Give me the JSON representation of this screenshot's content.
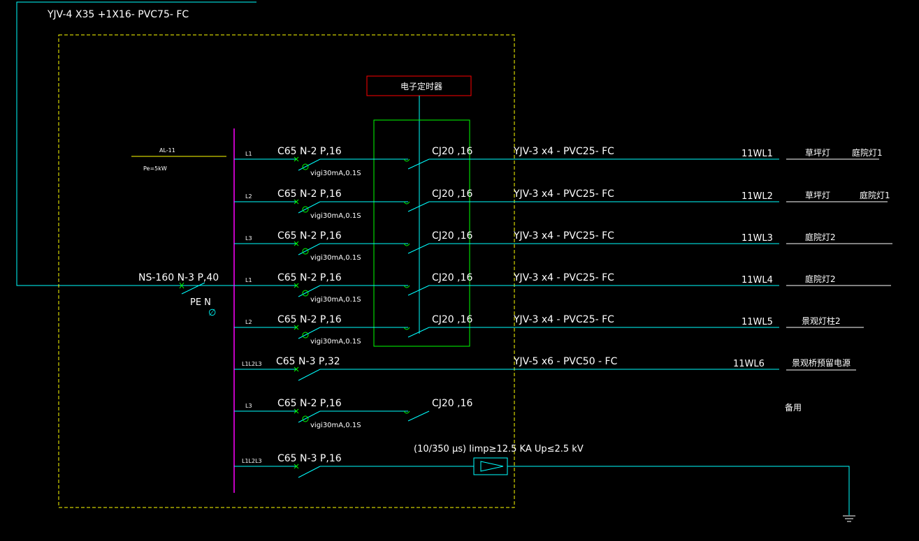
{
  "colors": {
    "background": "#000000",
    "wire": "#00ffff",
    "wire_dim": "#33cccc",
    "bus": "#ff00ff",
    "breaker": "#00ff00",
    "timer_box": "#ff0000",
    "contactor_box": "#00ff00",
    "enclosure": "#ffff00",
    "text": "#ffffff"
  },
  "incoming": {
    "cable": "YJV-4 X35 +1X16- PVC75- FC",
    "main_breaker": "NS-160 N-3 P,40",
    "pe_n": "PE N",
    "neutral_symbol": "∅"
  },
  "panel": {
    "name": "AL-11",
    "load": "Pe=5kW"
  },
  "timer": {
    "label": "电子定时器"
  },
  "circuits": [
    {
      "phase": "L1",
      "breaker": "C65 N-2 P,16",
      "rcd": "vigi30mA,0.1S",
      "contactor": "CJ20 ,16",
      "cable": "YJV-3 x4 - PVC25- FC",
      "id": "11WL1",
      "loads": [
        "草坪灯",
        "庭院灯1"
      ]
    },
    {
      "phase": "L2",
      "breaker": "C65 N-2 P,16",
      "rcd": "vigi30mA,0.1S",
      "contactor": "CJ20 ,16",
      "cable": "YJV-3 x4 - PVC25- FC",
      "id": "11WL2",
      "loads": [
        "草坪灯",
        "庭院灯1"
      ]
    },
    {
      "phase": "L3",
      "breaker": "C65 N-2 P,16",
      "rcd": "vigi30mA,0.1S",
      "contactor": "CJ20 ,16",
      "cable": "YJV-3 x4 - PVC25- FC",
      "id": "11WL3",
      "loads": [
        "庭院灯2"
      ]
    },
    {
      "phase": "L1",
      "breaker": "C65 N-2 P,16",
      "rcd": "vigi30mA,0.1S",
      "contactor": "CJ20 ,16",
      "cable": "YJV-3 x4 - PVC25- FC",
      "id": "11WL4",
      "loads": [
        "庭院灯2"
      ]
    },
    {
      "phase": "L2",
      "breaker": "C65 N-2 P,16",
      "rcd": "vigi30mA,0.1S",
      "contactor": "CJ20 ,16",
      "cable": "YJV-3 x4 - PVC25- FC",
      "id": "11WL5",
      "loads": [
        "景观灯柱2"
      ]
    },
    {
      "phase": "L1L2L3",
      "breaker": "C65 N-3 P,32",
      "rcd": "",
      "contactor": "",
      "cable": "YJV-5 x6 - PVC50 - FC",
      "id": "11WL6",
      "loads": [
        "景观桥预留电源"
      ]
    },
    {
      "phase": "L3",
      "breaker": "C65 N-2 P,16",
      "rcd": "vigi30mA,0.1S",
      "contactor": "CJ20 ,16",
      "cable": "",
      "id": "",
      "loads": [
        "备用"
      ]
    },
    {
      "phase": "L1L2L3",
      "breaker": "C65 N-3 P,16",
      "rcd": "",
      "contactor": "",
      "cable": "",
      "id": "",
      "loads": []
    }
  ],
  "spd": {
    "spec": "(10/350 μs)  Iimp≥12.5 KA   Up≤2.5 kV"
  }
}
